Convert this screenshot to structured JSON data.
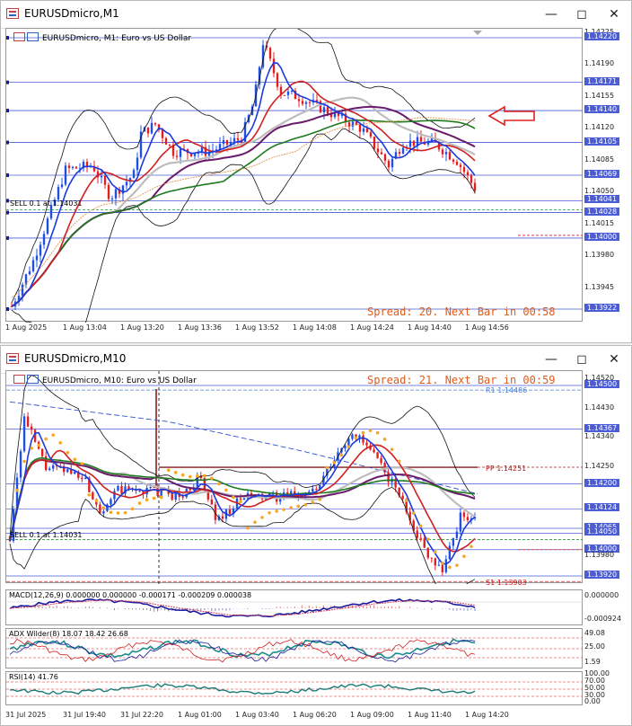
{
  "window1": {
    "title": "EURUSDmicro,M1",
    "symbol_desc": "EURUSDmicro, M1:  Euro vs US Dollar",
    "spread_text": "Spread: 20. Next Bar in 00:58",
    "sell_label": "SELL 0.1 at 1.14031",
    "price_labels": [
      "1.14225",
      "1.14220",
      "1.14190",
      "1.14171",
      "1.14155",
      "1.14140",
      "1.14120",
      "1.14105",
      "1.14085",
      "1.14069",
      "1.14050",
      "1.14041",
      "1.14028",
      "1.14015",
      "1.14000",
      "1.13980",
      "1.13945",
      "1.13922"
    ],
    "highlighted_prices": [
      "1.14220",
      "1.14171",
      "1.14140",
      "1.14105",
      "1.14069",
      "1.14041",
      "1.14028",
      "1.14000",
      "1.13922"
    ],
    "time_labels": [
      "1 Aug 2025",
      "1 Aug 13:04",
      "1 Aug 13:20",
      "1 Aug 13:36",
      "1 Aug 13:52",
      "1 Aug 14:08",
      "1 Aug 14:24",
      "1 Aug 14:40",
      "1 Aug 14:56"
    ]
  },
  "window2": {
    "title": "EURUSDmicro,M10",
    "symbol_desc": "EURUSDmicro, M10:  Euro vs US Dollar",
    "spread_text": "Spread: 21. Next Bar in 00:59",
    "sell_label": "SELL 0.1 at 1.14031",
    "r1_label": "R1 1.14486",
    "pp_label": "PP 1.14251",
    "s1_label": "S1 1.13903",
    "price_labels": [
      "1.14520",
      "1.14500",
      "1.14430",
      "1.14367",
      "1.14340",
      "1.14250",
      "1.14200",
      "1.14124",
      "1.14065",
      "1.14050",
      "1.14000",
      "1.13980",
      "1.13920"
    ],
    "highlighted_prices": [
      "1.14500",
      "1.14367",
      "1.14200",
      "1.14124",
      "1.14065",
      "1.14050",
      "1.14000",
      "1.13920"
    ],
    "time_labels": [
      "31 Jul 2025",
      "31 Jul 19:40",
      "31 Jul 22:20",
      "1 Aug 01:00",
      "1 Aug 03:40",
      "1 Aug 06:20",
      "1 Aug 09:00",
      "1 Aug 11:40",
      "1 Aug 14:20"
    ],
    "macd": {
      "label": "MACD(12,26,9) 0.000000 0.000000 -0.000171 -0.000209 0.000038",
      "axis": [
        "0.000000",
        "-0.000924"
      ]
    },
    "adx": {
      "label": "ADX Wilder(8) 18.07 18.42 26.68",
      "axis": [
        "49.08",
        "25.00",
        "1.59"
      ]
    },
    "rsi": {
      "label": "RSI(14) 41.76",
      "axis": [
        "100.00",
        "70.00",
        "50.00",
        "30.00",
        "0.00"
      ]
    }
  },
  "colors": {
    "accent": "#4a5cd6",
    "spread": "#e05a1a",
    "bull": "#2050e0",
    "bear": "#e02020",
    "psar": "#f5a623",
    "ma_green": "#1e7a1e",
    "ma_purple": "#6a1a6a",
    "ma_blue": "#1a3adf",
    "ma_red": "#d02020"
  }
}
